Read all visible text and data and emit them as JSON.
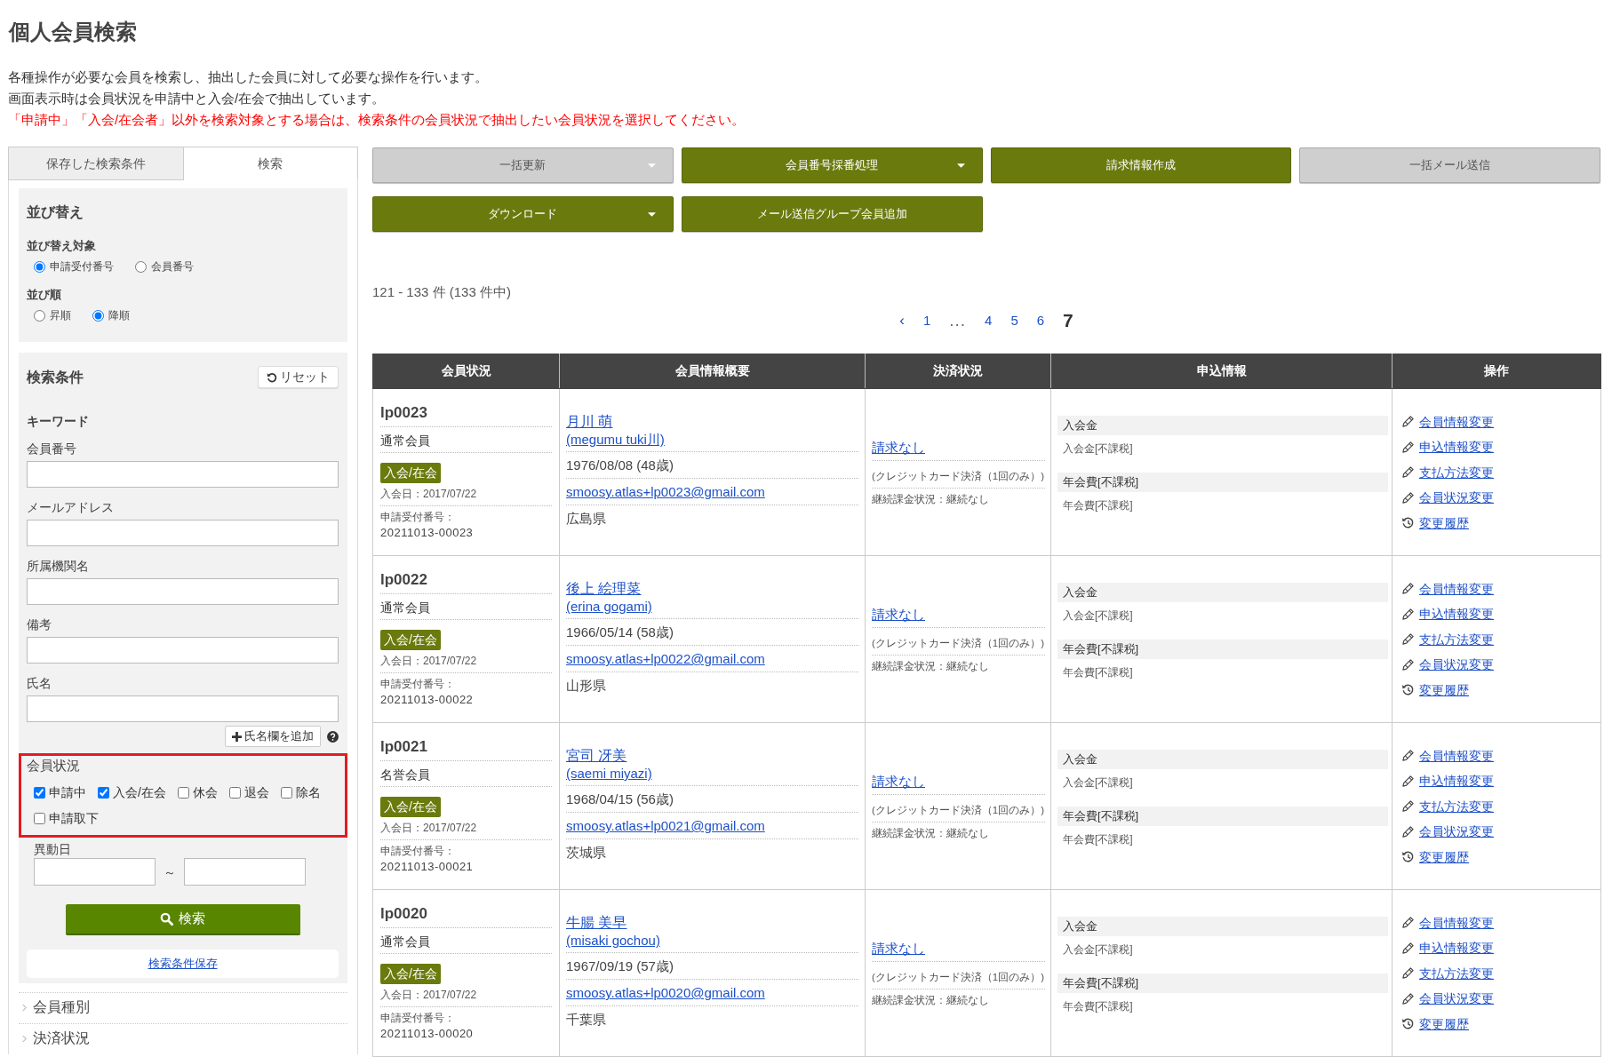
{
  "page": {
    "title": "個人会員検索",
    "description": [
      "各種操作が必要な会員を検索し、抽出した会員に対して必要な操作を行います。",
      "画面表示時は会員状況を申請中と入会/在会で抽出しています。"
    ],
    "notice": "「申請中」「入会/在会者」以外を検索対象とする場合は、検索条件の会員状況で抽出したい会員状況を選択してください。"
  },
  "sidebar": {
    "tabs": [
      {
        "label": "保存した検索条件",
        "selected": false
      },
      {
        "label": "検索",
        "selected": true
      }
    ],
    "sort": {
      "title": "並び替え",
      "groups": [
        {
          "label": "並び替え対象",
          "options": [
            {
              "label": "申請受付番号",
              "selected": true
            },
            {
              "label": "会員番号",
              "selected": false
            }
          ]
        },
        {
          "label": "並び順",
          "options": [
            {
              "label": "昇順",
              "selected": false
            },
            {
              "label": "降順",
              "selected": true
            }
          ]
        }
      ]
    },
    "search": {
      "title": "検索条件",
      "reset_button": "リセット",
      "keyword_heading": "キーワード",
      "fields": [
        {
          "label": "会員番号"
        },
        {
          "label": "メールアドレス"
        },
        {
          "label": "所属機関名"
        },
        {
          "label": "備考"
        },
        {
          "label": "氏名"
        }
      ],
      "add_name_button": "氏名欄を追加",
      "status": {
        "label": "会員状況",
        "highlighted": true,
        "options": [
          {
            "label": "申請中",
            "checked": true
          },
          {
            "label": "入会/在会",
            "checked": true
          },
          {
            "label": "休会",
            "checked": false
          },
          {
            "label": "退会",
            "checked": false
          },
          {
            "label": "除名",
            "checked": false
          },
          {
            "label": "申請取下",
            "checked": false
          }
        ]
      },
      "date_range": {
        "label": "異動日",
        "separator": "～"
      },
      "search_button": "検索",
      "save_link": "検索条件保存"
    },
    "sections": [
      {
        "label": "会員種別",
        "expanded": false
      },
      {
        "label": "決済状況",
        "expanded": false
      }
    ]
  },
  "toolbar": {
    "buttons": [
      {
        "label": "一括更新",
        "disabled": true,
        "dropdown": true
      },
      {
        "label": "会員番号採番処理",
        "disabled": false,
        "dropdown": true
      },
      {
        "label": "請求情報作成",
        "disabled": false,
        "dropdown": false
      },
      {
        "label": "一括メール送信",
        "disabled": true,
        "dropdown": false
      },
      {
        "label": "ダウンロード",
        "disabled": false,
        "dropdown": true
      },
      {
        "label": "メール送信グループ会員追加",
        "disabled": false,
        "dropdown": false
      }
    ]
  },
  "results": {
    "summary": "121 - 133 件 (133 件中)",
    "pagination": [
      {
        "label": "‹",
        "kind": "prev",
        "selected": false
      },
      {
        "label": "1",
        "kind": "page",
        "selected": false
      },
      {
        "label": "...",
        "kind": "gap",
        "selected": false
      },
      {
        "label": "4",
        "kind": "page",
        "selected": false
      },
      {
        "label": "5",
        "kind": "page",
        "selected": false
      },
      {
        "label": "6",
        "kind": "page",
        "selected": false
      },
      {
        "label": "7",
        "kind": "page",
        "selected": true
      }
    ]
  },
  "table": {
    "columns": [
      "会員状況",
      "会員情報概要",
      "決済状況",
      "申込情報",
      "操作"
    ],
    "rows": [
      {
        "member_id": "lp0023",
        "member_type": "通常会員",
        "status_badge": "入会/在会",
        "joined": "入会日：2017/07/22",
        "application_label": "申請受付番号：",
        "application_number": "20211013-00023",
        "name": "月川 萌",
        "name_romaji": "(megumu tuki川)",
        "birthdate": "1976/08/08 (48歳)",
        "email": "smoosy.atlas+lp0023@gmail.com",
        "prefecture": "広島県",
        "billing": "請求なし",
        "payment_method": "(クレジットカード決済（1回のみ）)",
        "recurring": "継続課金状況：継続なし",
        "fees": [
          {
            "heading": "入会金",
            "detail": "入会金[不課税]"
          },
          {
            "heading": "年会費[不課税]",
            "detail": "年会費[不課税]"
          }
        ],
        "actions": [
          {
            "label": "会員情報変更",
            "kind": "edit"
          },
          {
            "label": "申込情報変更",
            "kind": "edit"
          },
          {
            "label": "支払方法変更",
            "kind": "edit"
          },
          {
            "label": "会員状況変更",
            "kind": "edit"
          },
          {
            "label": "変更履歴",
            "kind": "history"
          }
        ]
      },
      {
        "member_id": "lp0022",
        "member_type": "通常会員",
        "status_badge": "入会/在会",
        "joined": "入会日：2017/07/22",
        "application_label": "申請受付番号：",
        "application_number": "20211013-00022",
        "name": "後上 絵理菜",
        "name_romaji": "(erina gogami)",
        "birthdate": "1966/05/14 (58歳)",
        "email": "smoosy.atlas+lp0022@gmail.com",
        "prefecture": "山形県",
        "billing": "請求なし",
        "payment_method": "(クレジットカード決済（1回のみ）)",
        "recurring": "継続課金状況：継続なし",
        "fees": [
          {
            "heading": "入会金",
            "detail": "入会金[不課税]"
          },
          {
            "heading": "年会費[不課税]",
            "detail": "年会費[不課税]"
          }
        ],
        "actions": [
          {
            "label": "会員情報変更",
            "kind": "edit"
          },
          {
            "label": "申込情報変更",
            "kind": "edit"
          },
          {
            "label": "支払方法変更",
            "kind": "edit"
          },
          {
            "label": "会員状況変更",
            "kind": "edit"
          },
          {
            "label": "変更履歴",
            "kind": "history"
          }
        ]
      },
      {
        "member_id": "lp0021",
        "member_type": "名誉会員",
        "status_badge": "入会/在会",
        "joined": "入会日：2017/07/22",
        "application_label": "申請受付番号：",
        "application_number": "20211013-00021",
        "name": "宮司 冴美",
        "name_romaji": "(saemi miyazi)",
        "birthdate": "1968/04/15 (56歳)",
        "email": "smoosy.atlas+lp0021@gmail.com",
        "prefecture": "茨城県",
        "billing": "請求なし",
        "payment_method": "(クレジットカード決済（1回のみ）)",
        "recurring": "継続課金状況：継続なし",
        "fees": [
          {
            "heading": "入会金",
            "detail": "入会金[不課税]"
          },
          {
            "heading": "年会費[不課税]",
            "detail": "年会費[不課税]"
          }
        ],
        "actions": [
          {
            "label": "会員情報変更",
            "kind": "edit"
          },
          {
            "label": "申込情報変更",
            "kind": "edit"
          },
          {
            "label": "支払方法変更",
            "kind": "edit"
          },
          {
            "label": "会員状況変更",
            "kind": "edit"
          },
          {
            "label": "変更履歴",
            "kind": "history"
          }
        ]
      },
      {
        "member_id": "lp0020",
        "member_type": "通常会員",
        "status_badge": "入会/在会",
        "joined": "入会日：2017/07/22",
        "application_label": "申請受付番号：",
        "application_number": "20211013-00020",
        "name": "牛腸 美早",
        "name_romaji": "(misaki gochou)",
        "birthdate": "1967/09/19 (57歳)",
        "email": "smoosy.atlas+lp0020@gmail.com",
        "prefecture": "千葉県",
        "billing": "請求なし",
        "payment_method": "(クレジットカード決済（1回のみ）)",
        "recurring": "継続課金状況：継続なし",
        "fees": [
          {
            "heading": "入会金",
            "detail": "入会金[不課税]"
          },
          {
            "heading": "年会費[不課税]",
            "detail": "年会費[不課税]"
          }
        ],
        "actions": [
          {
            "label": "会員情報変更",
            "kind": "edit"
          },
          {
            "label": "申込情報変更",
            "kind": "edit"
          },
          {
            "label": "支払方法変更",
            "kind": "edit"
          },
          {
            "label": "会員状況変更",
            "kind": "edit"
          },
          {
            "label": "変更履歴",
            "kind": "history"
          }
        ]
      }
    ]
  }
}
